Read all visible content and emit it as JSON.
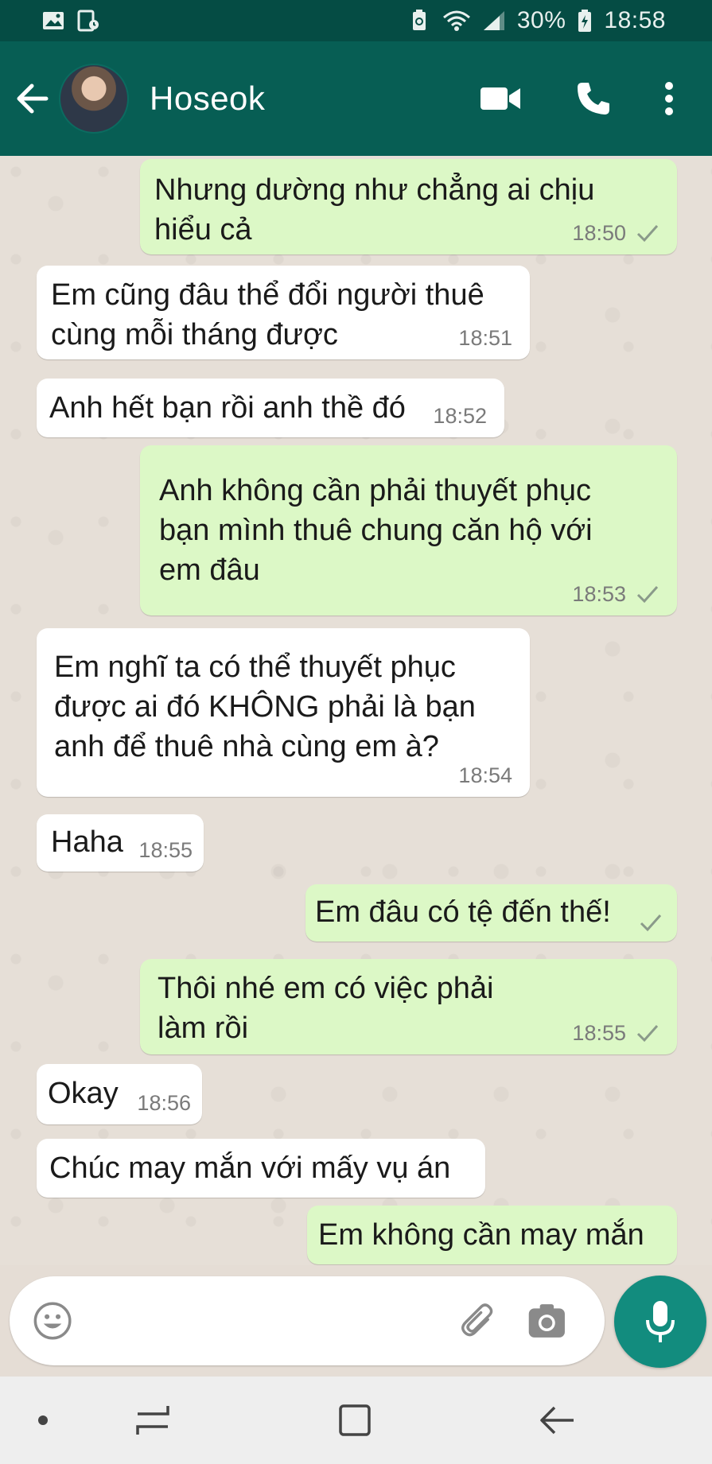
{
  "status_bar": {
    "battery": "30%",
    "time": "18:58",
    "icons": [
      "gallery-icon",
      "screenshot-icon",
      "recycle-icon",
      "wifi-icon",
      "signal-icon",
      "battery-icon"
    ]
  },
  "header": {
    "contact_name": "Hoseok",
    "icons": [
      "back-arrow-icon",
      "video-call-icon",
      "phone-icon",
      "more-vert-icon"
    ]
  },
  "messages": [
    {
      "direction": "out",
      "text": "Nhưng dường như chẳng ai chịu\nhiểu cả",
      "time": "18:50",
      "status": "sent"
    },
    {
      "direction": "in",
      "text": "Em cũng đâu thể đổi người thuê\ncùng mỗi tháng được",
      "time": "18:51"
    },
    {
      "direction": "in",
      "text": "Anh hết bạn rồi anh thề đó",
      "time": "18:52"
    },
    {
      "direction": "out",
      "text": "Anh không cần phải thuyết phục\nbạn mình thuê chung căn hộ với\nem đâu",
      "time": "18:53",
      "status": "sent"
    },
    {
      "direction": "in",
      "text": "Em nghĩ ta có thể thuyết phục\nđược ai đó KHÔNG phải là bạn\nanh để thuê nhà cùng em à?",
      "time": "18:54"
    },
    {
      "direction": "in",
      "text": "Haha",
      "time": "18:55"
    },
    {
      "direction": "out",
      "text": "Em đâu có tệ đến thế!",
      "time": "",
      "status": "sent"
    },
    {
      "direction": "out",
      "text": "Thôi nhé em có việc phải\nlàm rồi",
      "time": "18:55",
      "status": "sent"
    },
    {
      "direction": "in",
      "text": "Okay",
      "time": "18:56"
    },
    {
      "direction": "in",
      "text": "Chúc may mắn với mấy vụ án",
      "time": ""
    },
    {
      "direction": "out",
      "text": "Em không cần may mắn",
      "time": ""
    }
  ],
  "input": {
    "placeholder": "",
    "icons": [
      "emoji-icon",
      "attach-icon",
      "camera-icon",
      "mic-icon"
    ]
  },
  "colors": {
    "status_bar": "#054c44",
    "header": "#075e54",
    "outgoing_bubble": "#dcf8c6",
    "incoming_bubble": "#ffffff",
    "chat_bg": "#e6dfd7",
    "accent": "#128c7e"
  },
  "nav_bar": {
    "icons": [
      "dot-icon",
      "recent-apps-icon",
      "home-icon",
      "back-icon"
    ]
  }
}
